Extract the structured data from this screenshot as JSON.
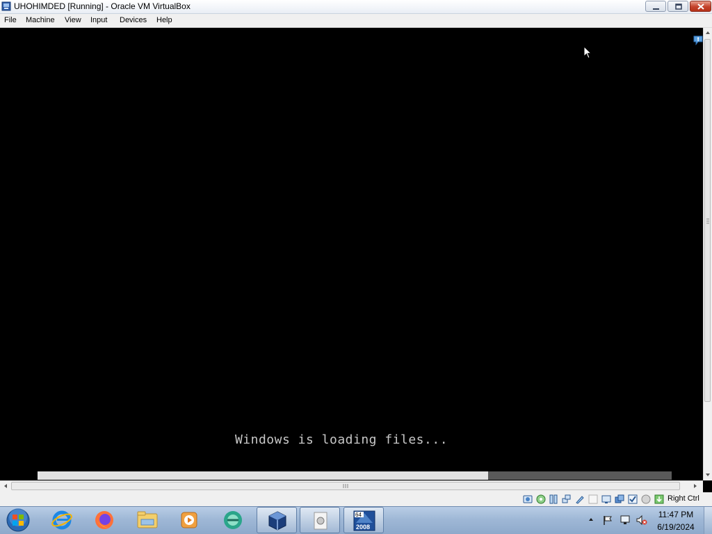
{
  "window": {
    "title": "UHOHIMDED [Running] - Oracle VM VirtualBox"
  },
  "menu": {
    "items": [
      "File",
      "Machine",
      "View",
      "Input",
      "Devices",
      "Help"
    ]
  },
  "vm": {
    "boot_message": "Windows is loading files..."
  },
  "statusbar": {
    "host_key": "Right Ctrl",
    "icons": [
      "hard-disk-icon",
      "optical-drive-icon",
      "audio-icon",
      "network-icon",
      "usb-icon",
      "shared-folders-icon",
      "display-icon",
      "video-capture-icon",
      "recording-icon",
      "cpu-icon",
      "mouse-integration-icon",
      "keyboard-capture-icon"
    ]
  },
  "taskbar": {
    "pinned": [
      "internet-explorer-icon",
      "firefox-icon",
      "file-explorer-icon",
      "media-player-icon",
      "greenshot-icon",
      "virtualbox-icon",
      "vm-window-icon",
      "windows-server-2008-icon"
    ],
    "active_badge": "64",
    "active_label": "2008",
    "tray_icons": [
      "action-center-flag-icon",
      "network-icon",
      "volume-muted-icon"
    ],
    "clock_time": "11:47 PM",
    "clock_date": "6/19/2024"
  },
  "colors": {
    "vm_background": "#000000",
    "boot_text": "#c8c8c8",
    "taskbar": "#9fb8d6",
    "close_button": "#c4422b"
  }
}
